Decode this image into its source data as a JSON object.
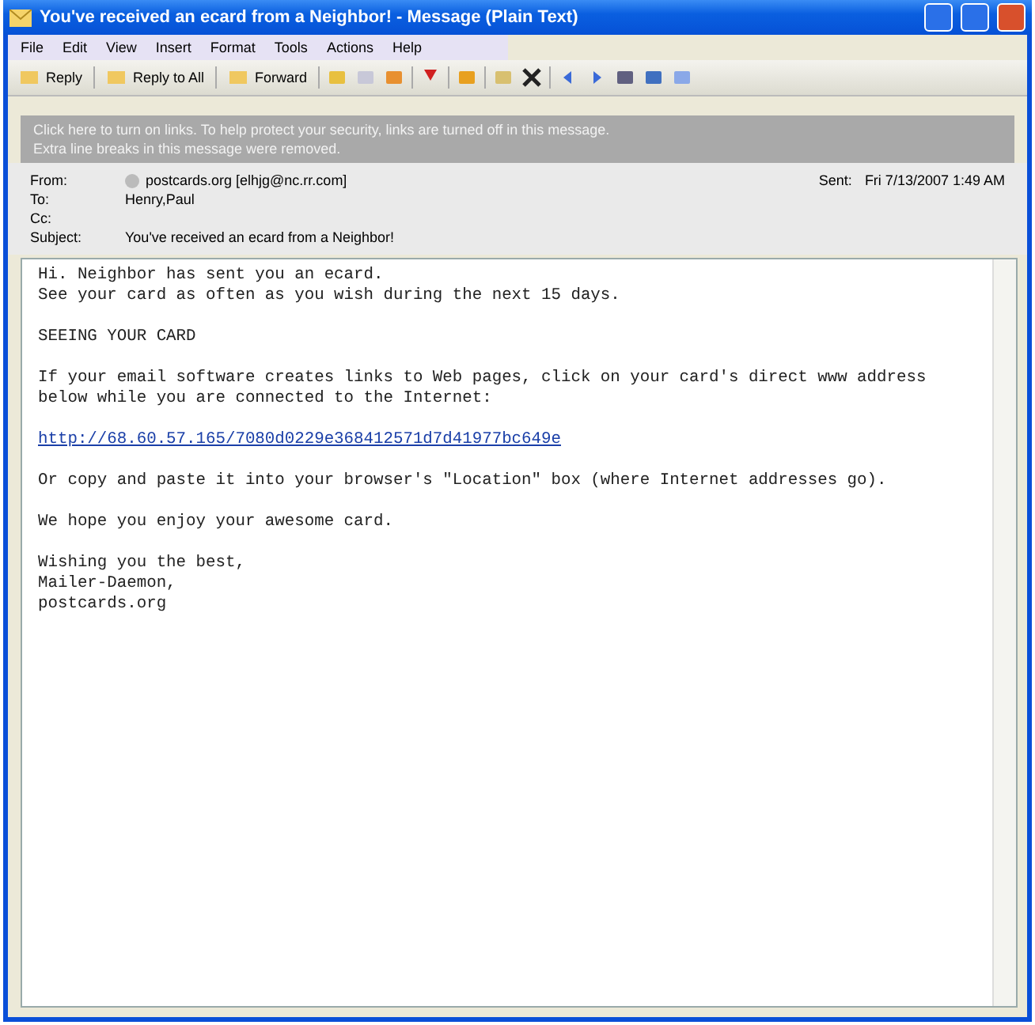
{
  "window": {
    "title": "You've received an ecard from a Neighbor! - Message (Plain Text)"
  },
  "menu": [
    "File",
    "Edit",
    "View",
    "Insert",
    "Format",
    "Tools",
    "Actions",
    "Help"
  ],
  "toolbar": [
    {
      "label": "Reply"
    },
    {
      "label": "Reply to All"
    },
    {
      "label": "Forward"
    }
  ],
  "infobar": [
    "Click here to turn on links. To help protect your security, links are turned off in this message.",
    "Extra line breaks in this message were removed."
  ],
  "header": {
    "from_label": "From:",
    "from": "postcards.org [elhjg@nc.rr.com]",
    "sent_label": "Sent:",
    "sent": "Fri 7/13/2007 1:49 AM",
    "to_label": "To:",
    "to": "Henry,Paul",
    "cc_label": "Cc:",
    "subject_label": "Subject:",
    "subject": "You've received an ecard from a Neighbor!"
  },
  "body": [
    {
      "kind": "text",
      "lines": [
        "Hi. Neighbor has sent you an ecard.",
        "See your card as often as you wish during the next 15 days."
      ]
    },
    {
      "kind": "text",
      "lines": [
        "SEEING YOUR CARD"
      ]
    },
    {
      "kind": "text",
      "lines": [
        "If your email software creates links to Web pages, click on your card's direct www address",
        "below while you are connected to the Internet:"
      ]
    },
    {
      "kind": "link",
      "lines": [
        "http://68.60.57.165/7080d0229e368412571d7d41977bc649e"
      ]
    },
    {
      "kind": "text",
      "lines": [
        "Or copy and paste it into your browser's \"Location\" box (where Internet addresses go)."
      ]
    },
    {
      "kind": "text",
      "lines": [
        "We hope you enjoy your awesome card."
      ]
    },
    {
      "kind": "text",
      "lines": [
        "Wishing you the best,",
        "Mailer-Daemon,",
        "postcards.org"
      ]
    }
  ]
}
